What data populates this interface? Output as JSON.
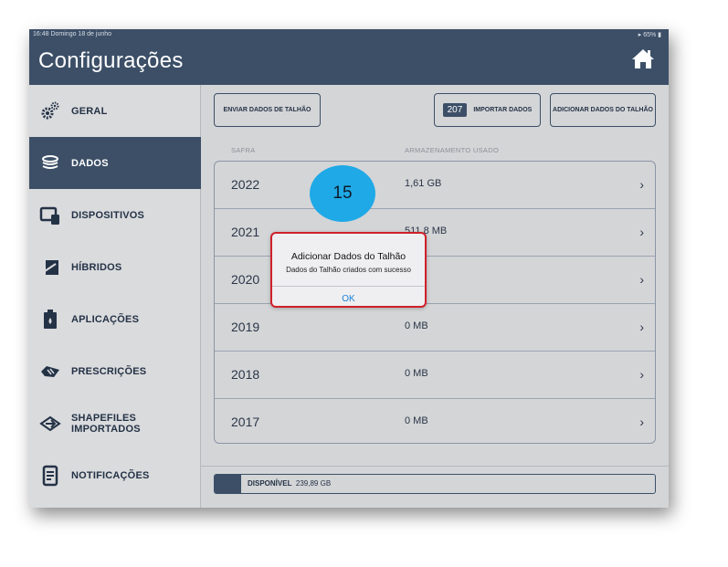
{
  "status_bar": {
    "time_date": "16:48  Domingo 18 de junho",
    "battery": "65%"
  },
  "header": {
    "title": "Configurações",
    "home_icon": "home-icon"
  },
  "sidebar": {
    "items": [
      {
        "label": "GERAL",
        "icon": "gears-icon",
        "active": false
      },
      {
        "label": "DADOS",
        "icon": "database-icon",
        "active": true
      },
      {
        "label": "DISPOSITIVOS",
        "icon": "devices-icon",
        "active": false
      },
      {
        "label": "HÍBRIDOS",
        "icon": "hybrid-icon",
        "active": false
      },
      {
        "label": "APLICAÇÕES",
        "icon": "application-icon",
        "active": false
      },
      {
        "label": "PRESCRIÇÕES",
        "icon": "prescription-icon",
        "active": false
      },
      {
        "label": "SHAPEFILES IMPORTADOS",
        "icon": "shapefile-icon",
        "active": false
      },
      {
        "label": "NOTIFICAÇÕES",
        "icon": "notification-icon",
        "active": false
      }
    ]
  },
  "toolbar": {
    "send_label": "ENVIAR DADOS DE TALHÃO",
    "import_count": "207",
    "import_label": "IMPORTAR DADOS",
    "add_label": "ADICIONAR DADOS DO TALHÃO"
  },
  "table": {
    "headers": {
      "season": "SAFRA",
      "storage": "ARMAZENAMENTO USADO"
    },
    "rows": [
      {
        "year": "2022",
        "size": "1,61 GB"
      },
      {
        "year": "2021",
        "size": "511,8 MB"
      },
      {
        "year": "2020",
        "size": ""
      },
      {
        "year": "2019",
        "size": "0 MB"
      },
      {
        "year": "2018",
        "size": "0 MB"
      },
      {
        "year": "2017",
        "size": "0 MB"
      }
    ]
  },
  "storage": {
    "label": "DISPONÍVEL",
    "value": "239,89 GB",
    "used_fraction": 0.06
  },
  "callout": {
    "number": "15",
    "color": "#1fa9e6"
  },
  "dialog": {
    "title": "Adicionar Dados do Talhão",
    "message": "Dados do Talhão criados com sucesso",
    "ok_label": "OK",
    "highlight_color": "#d0202a"
  },
  "colors": {
    "primary": "#3c4f67",
    "background": "#d4d5d7",
    "link": "#1d7fd6"
  }
}
